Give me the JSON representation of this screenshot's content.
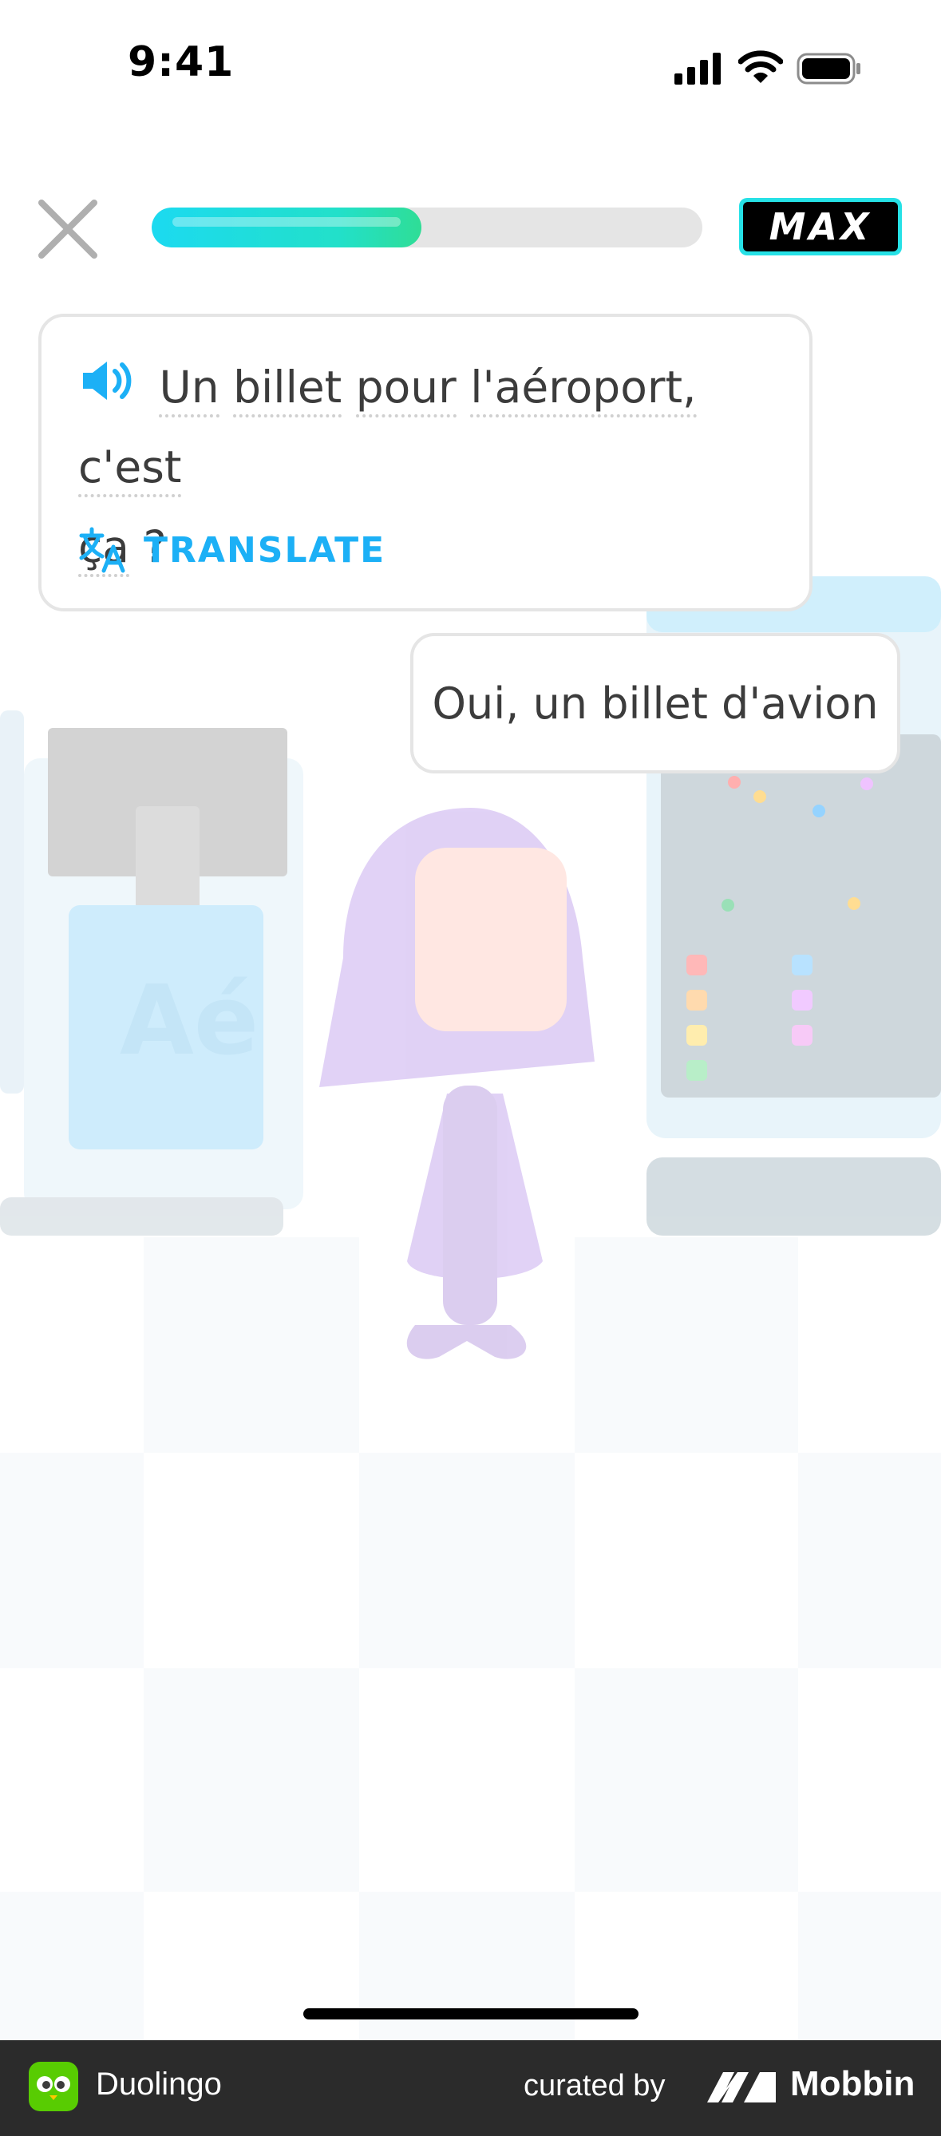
{
  "status_bar": {
    "time": "9:41"
  },
  "lesson": {
    "progress": 0.49,
    "badge_label": "MAX"
  },
  "prompt_bubble": {
    "words_line1": [
      "Un",
      "billet",
      "pour",
      "l'aéroport,",
      "c'est"
    ],
    "words_line2": [
      "ça",
      "?"
    ],
    "translate_label": "TRANSLATE"
  },
  "reply_bubble": {
    "text": "Oui, un billet d'avion"
  },
  "footer": {
    "app_name": "Duolingo",
    "curated_by": "curated by",
    "brand": "Mobbin"
  },
  "colors": {
    "accent_blue": "#1cb0f6",
    "progress_start": "#1cdaf0",
    "progress_end": "#2fdd96",
    "max_border": "#26e1e6"
  },
  "icons": [
    "close-icon",
    "speaker-icon",
    "translate-icon",
    "signal-icon",
    "wifi-icon",
    "battery-icon"
  ]
}
